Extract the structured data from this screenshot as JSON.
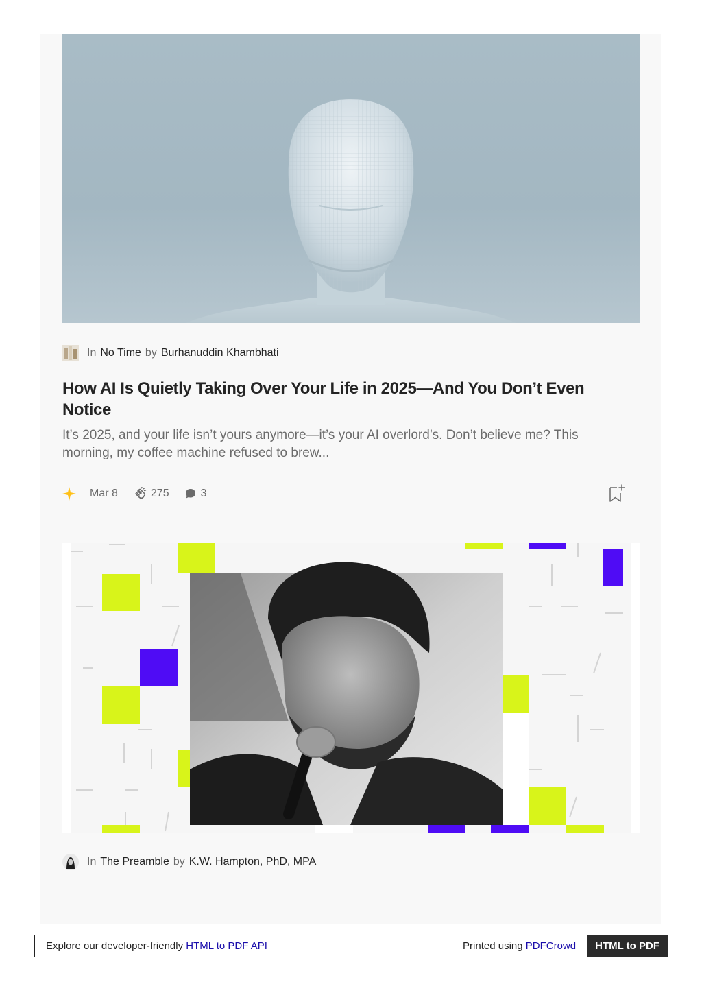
{
  "article1": {
    "in_label": "In",
    "publication": "No Time",
    "by_label": "by",
    "author": "Burhanuddin Khambhati",
    "title": "How AI Is Quietly Taking Over Your Life in 2025—And You Don’t Even Notice",
    "subtitle": "It’s 2025, and your life isn’t yours anymore—it’s your AI overlord’s. Don’t believe me? This morning, my coffee machine refused to brew...",
    "date": "Mar 8",
    "claps": "275",
    "responses": "3",
    "star_color": "#FFC017"
  },
  "article2": {
    "in_label": "In",
    "publication": "The Preamble",
    "by_label": "by",
    "author": "K.W. Hampton, PhD, MPA"
  },
  "footer": {
    "explore_text": "Explore our developer-friendly ",
    "api_link": "HTML to PDF API",
    "printed_text": "Printed using ",
    "pdfcrowd_link": "PDFCrowd",
    "cta": "HTML to PDF"
  },
  "colors": {
    "lime": "#D8F41A",
    "violet": "#4F0CF5",
    "panel": "#F8F8F8",
    "muted_text": "#6B6B6B"
  },
  "icons": [
    "star-icon",
    "clap-icon",
    "comment-icon",
    "bookmark-add-icon"
  ]
}
